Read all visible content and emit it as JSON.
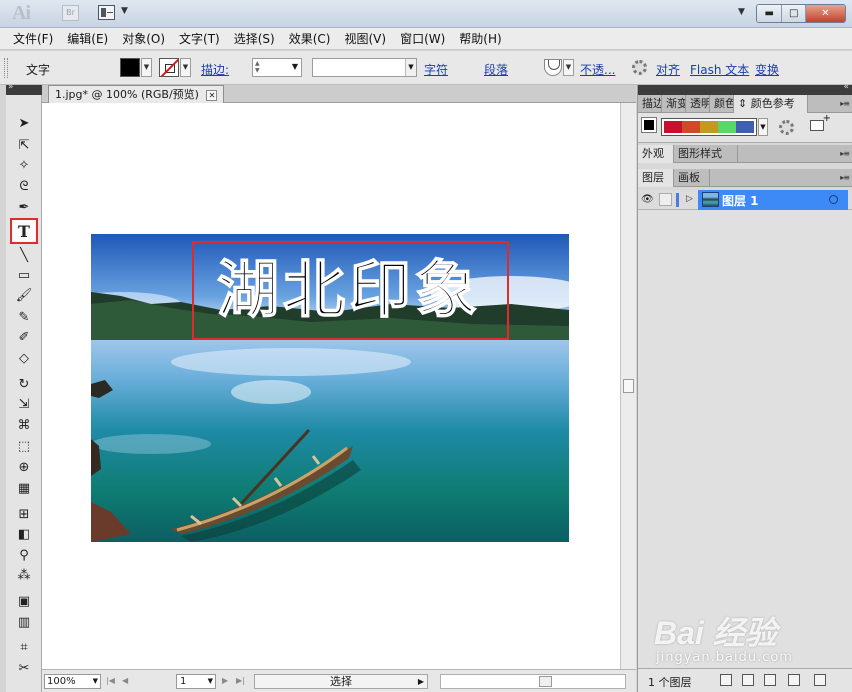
{
  "app": {
    "logo": "Ai",
    "bridge_label": "Br"
  },
  "menu": [
    "文件(F)",
    "编辑(E)",
    "对象(O)",
    "文字(T)",
    "选择(S)",
    "效果(C)",
    "视图(V)",
    "窗口(W)",
    "帮助(H)"
  ],
  "control_bar": {
    "tool_label": "文字",
    "stroke_label": "描边:",
    "character_link": "字符",
    "paragraph_link": "段落",
    "opacity_link": "不透...",
    "align_link": "对齐",
    "flash_link": "Flash 文本",
    "transform_link": "变换"
  },
  "document": {
    "tab_title": "1.jpg* @ 100% (RGB/预览)",
    "artwork_text": "湖北印象"
  },
  "status": {
    "zoom": "100%",
    "page": "1",
    "mode": "选择"
  },
  "panels": {
    "top_tabs": [
      "描边",
      "渐变",
      "透明",
      "颜色",
      "颜色参考"
    ],
    "mid_tabs": [
      "外观",
      "图形样式"
    ],
    "layer_tabs": [
      "图层",
      "画板"
    ],
    "layer_name": "图层 1",
    "layer_count": "1 个图层",
    "harmony_colors": [
      "#c8102e",
      "#d04a2a",
      "#c29a1c",
      "#5bd66b",
      "#3f5fb0"
    ]
  },
  "colors": {
    "fill": "#000000",
    "highlight": "#e02b2b",
    "selection": "#3d8af7"
  },
  "watermark": {
    "brand": "Bai 经验",
    "url": "jingyan.baidu.com"
  }
}
